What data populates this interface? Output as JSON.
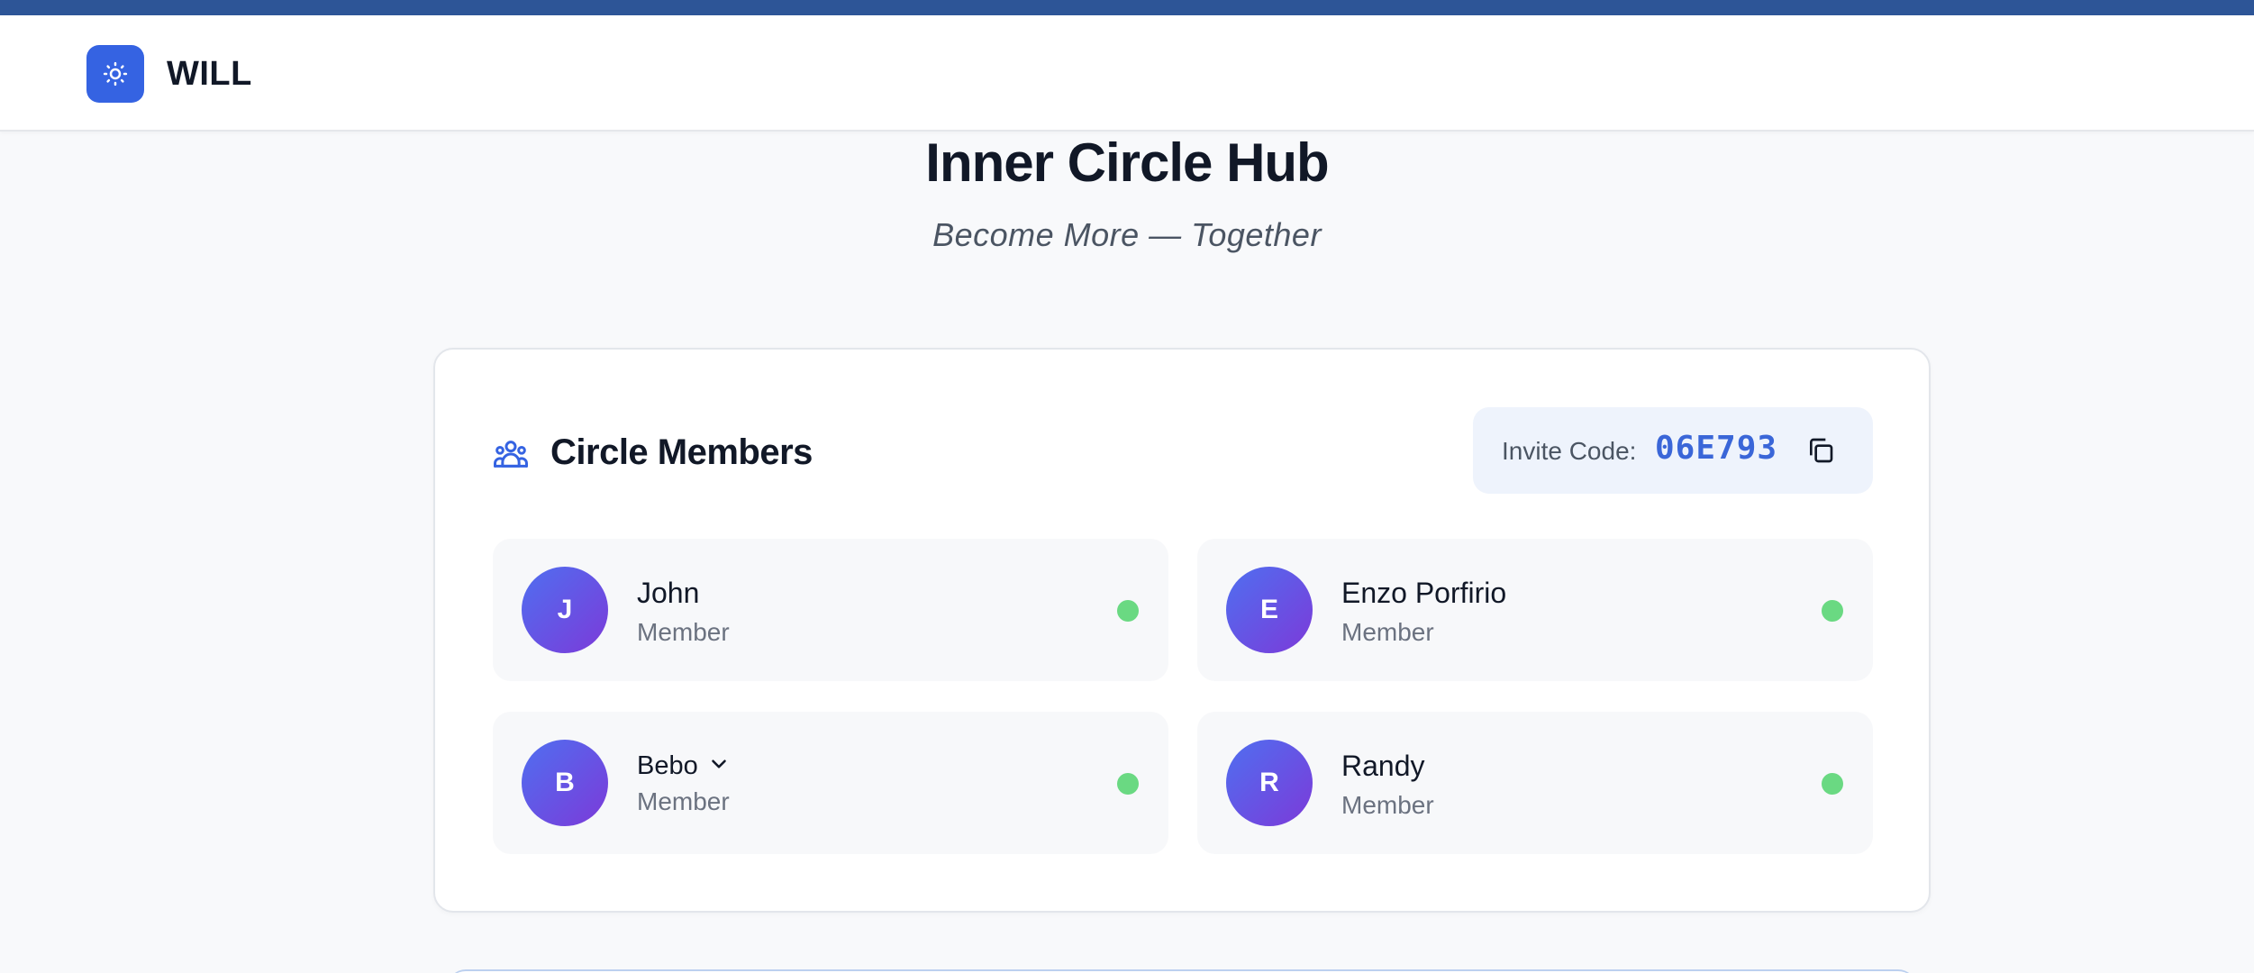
{
  "brand": {
    "name": "WILL",
    "logo_icon": "sun-icon",
    "accent": "#3563e2"
  },
  "hero": {
    "title": "Inner Circle Hub",
    "subtitle": "Become More — Together"
  },
  "members_card": {
    "icon": "users-group-icon",
    "title": "Circle Members",
    "invite": {
      "label": "Invite Code:",
      "code": "06E793",
      "copy_icon": "copy-icon"
    },
    "members": [
      {
        "initial": "J",
        "name": "John",
        "role": "Member",
        "status": "online"
      },
      {
        "initial": "E",
        "name": "Enzo Porfirio",
        "role": "Member",
        "status": "online"
      },
      {
        "initial": "B",
        "name": "Bebo",
        "role": "Member",
        "status": "online",
        "has_dropdown": true
      },
      {
        "initial": "R",
        "name": "Randy",
        "role": "Member",
        "status": "online"
      }
    ]
  },
  "colors": {
    "top_strip": "#2d5597",
    "online": "#6ad982",
    "avatar_gradient": [
      "#4f6ff0",
      "#7c3ad9"
    ],
    "invite_code": "#3a66d8"
  }
}
